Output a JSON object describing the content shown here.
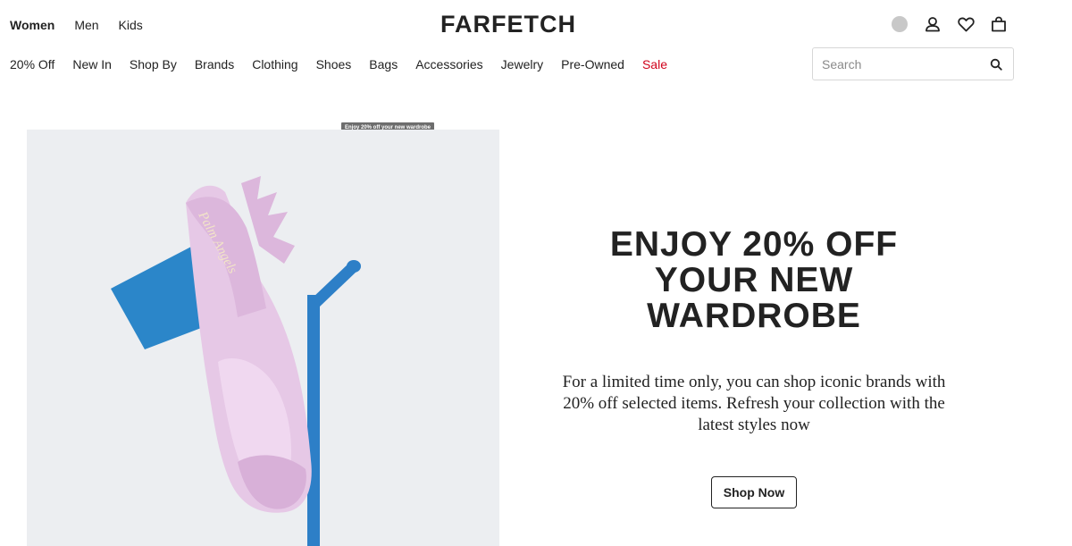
{
  "header": {
    "gender_tabs": [
      {
        "label": "Women",
        "active": true
      },
      {
        "label": "Men",
        "active": false
      },
      {
        "label": "Kids",
        "active": false
      }
    ],
    "logo": "FARFETCH",
    "icons": [
      "region-flag-icon",
      "account-icon",
      "wishlist-heart-icon",
      "shopping-bag-icon"
    ]
  },
  "nav": {
    "items": [
      {
        "label": "20% Off"
      },
      {
        "label": "New In"
      },
      {
        "label": "Shop By"
      },
      {
        "label": "Brands"
      },
      {
        "label": "Clothing"
      },
      {
        "label": "Shoes"
      },
      {
        "label": "Bags"
      },
      {
        "label": "Accessories"
      },
      {
        "label": "Jewelry"
      },
      {
        "label": "Pre-Owned"
      },
      {
        "label": "Sale"
      }
    ],
    "sale_color": "#d0021b"
  },
  "search": {
    "placeholder": "Search",
    "value": ""
  },
  "hero": {
    "tooltip": "Enjoy 20% off your new wardrobe",
    "headline_lines": [
      "ENJOY 20% OFF",
      "YOUR NEW",
      "WARDROBE"
    ],
    "body": "For a limited time only, you can shop iconic brands with 20% off selected items. Refresh your collection with the latest styles now",
    "cta_label": "Shop Now",
    "shoe_brand_text": "Palm Angels",
    "colors": {
      "background": "#eceef1",
      "shoe": "#e6c8e6",
      "stand": "#2d7fc7"
    }
  }
}
